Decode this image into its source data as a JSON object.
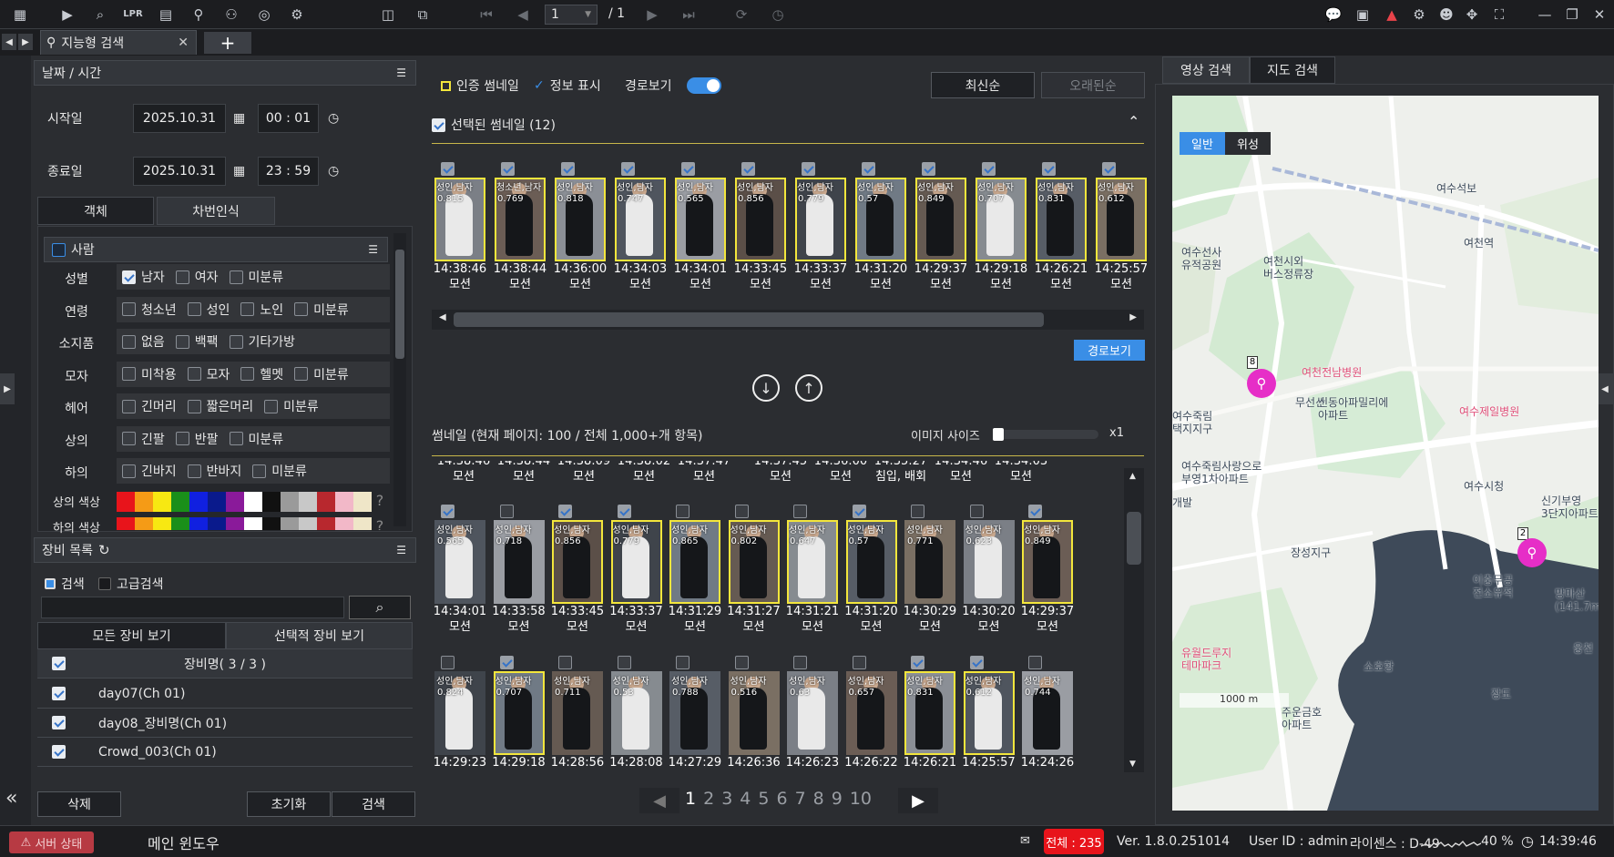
{
  "toolbar": {
    "page_current": "1",
    "page_total": "/ 1"
  },
  "tabs": {
    "main_tab_label": "지능형 검색",
    "add_tab_label": "+"
  },
  "datetime": {
    "section_title": "날짜 / 시간",
    "start_label": "시작일",
    "start_date": "2025.10.31",
    "start_time": "00 : 01",
    "end_label": "종료일",
    "end_date": "2025.10.31",
    "end_time": "23 : 59"
  },
  "search_tabs": [
    "객체",
    "차번인식"
  ],
  "person": {
    "section_title": "사람",
    "rows": [
      {
        "label": "성별",
        "options": [
          {
            "text": "남자",
            "checked": true
          },
          {
            "text": "여자",
            "checked": false
          },
          {
            "text": "미분류",
            "checked": false
          }
        ]
      },
      {
        "label": "연령",
        "options": [
          {
            "text": "청소년",
            "checked": false
          },
          {
            "text": "성인",
            "checked": false
          },
          {
            "text": "노인",
            "checked": false
          },
          {
            "text": "미분류",
            "checked": false
          }
        ]
      },
      {
        "label": "소지품",
        "options": [
          {
            "text": "없음",
            "checked": false
          },
          {
            "text": "백팩",
            "checked": false
          },
          {
            "text": "기타가방",
            "checked": false
          }
        ]
      },
      {
        "label": "모자",
        "options": [
          {
            "text": "미착용",
            "checked": false
          },
          {
            "text": "모자",
            "checked": false
          },
          {
            "text": "헬멧",
            "checked": false
          },
          {
            "text": "미분류",
            "checked": false
          }
        ]
      },
      {
        "label": "헤어",
        "options": [
          {
            "text": "긴머리",
            "checked": false
          },
          {
            "text": "짧은머리",
            "checked": false
          },
          {
            "text": "미분류",
            "checked": false
          }
        ]
      },
      {
        "label": "상의",
        "options": [
          {
            "text": "긴팔",
            "checked": false
          },
          {
            "text": "반팔",
            "checked": false
          },
          {
            "text": "미분류",
            "checked": false
          }
        ]
      },
      {
        "label": "하의",
        "options": [
          {
            "text": "긴바지",
            "checked": false
          },
          {
            "text": "반바지",
            "checked": false
          },
          {
            "text": "미분류",
            "checked": false
          }
        ]
      }
    ],
    "top_color_label": "상의 색상",
    "bottom_color_label": "하의 색상",
    "colors": [
      "#e8141b",
      "#f59b16",
      "#f7e812",
      "#1a8f1a",
      "#1020e0",
      "#0a1a8c",
      "#8a1a9a",
      "#ffffff",
      "#111111",
      "#9a9a9a",
      "#c8c8c8",
      "#b8282e",
      "#f2b8c8",
      "#efe6c8"
    ]
  },
  "devices": {
    "section_title": "장비 목록",
    "mode_basic": "검색",
    "mode_advanced": "고급검색",
    "search_value": "",
    "view_all": "모든 장비 보기",
    "view_selected": "선택적 장비 보기",
    "header": "장비명( 3 / 3 )",
    "items": [
      "day07(Ch 01)",
      "day08_장비명(Ch 01)",
      "Crowd_003(Ch 01)"
    ],
    "delete_button": "삭제",
    "reset_button": "초기화",
    "search_button": "검색"
  },
  "center": {
    "auth_thumb_label": "인증 썸네일",
    "info_label": "정보 표시",
    "route_label": "경로보기",
    "newest_button": "최신순",
    "oldest_button": "오래된순",
    "selected_header": "선택된 썸네일 (12)",
    "route_button": "경로보기",
    "thumb_header": "썸네일 (현재 페이지: 100 / 전체 1,000+개 항목)",
    "image_size_label": "이미지 사이즈",
    "image_size_value": "x1",
    "selected_thumbs": [
      {
        "tag": "성인,남자",
        "score": "0.815",
        "time": "14:38:46",
        "event": "모션"
      },
      {
        "tag": "청소년,남자",
        "score": "0.769",
        "time": "14:38:44",
        "event": "모션"
      },
      {
        "tag": "성인,남자",
        "score": "0.818",
        "time": "14:36:00",
        "event": "모션"
      },
      {
        "tag": "성인,남자",
        "score": "0.747",
        "time": "14:34:03",
        "event": "모션"
      },
      {
        "tag": "성인,남자",
        "score": "0.565",
        "time": "14:34:01",
        "event": "모션"
      },
      {
        "tag": "성인,남자",
        "score": "0.856",
        "time": "14:33:45",
        "event": "모션"
      },
      {
        "tag": "성인,남자",
        "score": "0.779",
        "time": "14:33:37",
        "event": "모션"
      },
      {
        "tag": "성인,남자",
        "score": "0.57",
        "time": "14:31:20",
        "event": "모션"
      },
      {
        "tag": "성인,남자",
        "score": "0.849",
        "time": "14:29:37",
        "event": "모션"
      },
      {
        "tag": "성인,남자",
        "score": "0.707",
        "time": "14:29:18",
        "event": "모션"
      },
      {
        "tag": "성인,남자",
        "score": "0.831",
        "time": "14:26:21",
        "event": "모션"
      },
      {
        "tag": "성인,남자",
        "score": "0.612",
        "time": "14:25:57",
        "event": "모션"
      }
    ],
    "partial_row": [
      {
        "time": "14:38:46",
        "event": "모션"
      },
      {
        "time": "14:38:44",
        "event": "모션"
      },
      {
        "time": "14:38:09",
        "event": "모션"
      },
      {
        "time": "14:38:02",
        "event": "모션"
      },
      {
        "time": "14:37:47",
        "event": "모션"
      },
      {
        "time": "14:37:45",
        "event": "모션"
      },
      {
        "time": "14:36:00",
        "event": "모션"
      },
      {
        "time": "14:35:27",
        "event": "침입, 배회"
      },
      {
        "time": "14:34:46",
        "event": "모션"
      },
      {
        "time": "14:34:03",
        "event": "모션"
      }
    ],
    "grid_row1": [
      {
        "tag": "성인,남자",
        "score": "0.565",
        "time": "14:34:01",
        "event": "모션",
        "checked": true,
        "hl": false
      },
      {
        "tag": "성인,남자",
        "score": "0.718",
        "time": "14:33:58",
        "event": "모션",
        "checked": false,
        "hl": false
      },
      {
        "tag": "성인,남자",
        "score": "0.856",
        "time": "14:33:45",
        "event": "모션",
        "checked": true,
        "hl": true
      },
      {
        "tag": "성인,남자",
        "score": "0.779",
        "time": "14:33:37",
        "event": "모션",
        "checked": true,
        "hl": true
      },
      {
        "tag": "성인,남자",
        "score": "0.865",
        "time": "14:31:29",
        "event": "모션",
        "checked": false,
        "hl": true
      },
      {
        "tag": "성인,남자",
        "score": "0.802",
        "time": "14:31:27",
        "event": "모션",
        "checked": false,
        "hl": true
      },
      {
        "tag": "성인,남자",
        "score": "0.647",
        "time": "14:31:21",
        "event": "모션",
        "checked": false,
        "hl": true
      },
      {
        "tag": "성인,남자",
        "score": "0.57",
        "time": "14:31:20",
        "event": "모션",
        "checked": true,
        "hl": true
      },
      {
        "tag": "성인,남자",
        "score": "0.771",
        "time": "14:30:29",
        "event": "모션",
        "checked": false,
        "hl": false
      },
      {
        "tag": "성인,남자",
        "score": "0.623",
        "time": "14:30:20",
        "event": "모션",
        "checked": false,
        "hl": false
      },
      {
        "tag": "성인,남자",
        "score": "0.849",
        "time": "14:29:37",
        "event": "모션",
        "checked": true,
        "hl": true
      }
    ],
    "grid_row2": [
      {
        "tag": "성인,남자",
        "score": "0.824",
        "time": "14:29:23",
        "checked": false,
        "hl": false
      },
      {
        "tag": "성인,남자",
        "score": "0.707",
        "time": "14:29:18",
        "checked": true,
        "hl": true
      },
      {
        "tag": "성인,남자",
        "score": "0.711",
        "time": "14:28:56",
        "checked": false,
        "hl": false
      },
      {
        "tag": "성인,남자",
        "score": "0.53",
        "time": "14:28:08",
        "checked": false,
        "hl": false
      },
      {
        "tag": "성인,남자",
        "score": "0.788",
        "time": "14:27:29",
        "checked": false,
        "hl": false
      },
      {
        "tag": "성인,남자",
        "score": "0.516",
        "time": "14:26:36",
        "checked": false,
        "hl": false
      },
      {
        "tag": "성인,남자",
        "score": "0.63",
        "time": "14:26:23",
        "checked": false,
        "hl": false
      },
      {
        "tag": "성인,남자",
        "score": "0.657",
        "time": "14:26:22",
        "checked": false,
        "hl": false
      },
      {
        "tag": "성인,남자",
        "score": "0.831",
        "time": "14:26:21",
        "checked": true,
        "hl": true
      },
      {
        "tag": "성인,남자",
        "score": "0.612",
        "time": "14:25:57",
        "checked": true,
        "hl": true
      },
      {
        "tag": "성인,남자",
        "score": "0.744",
        "time": "14:24:26",
        "checked": false,
        "hl": false
      }
    ],
    "pages": [
      "1",
      "2",
      "3",
      "4",
      "5",
      "6",
      "7",
      "8",
      "9",
      "10"
    ],
    "current_page": "1"
  },
  "right": {
    "tab_video": "영상 검색",
    "tab_map": "지도 검색",
    "map_mode_normal": "일반",
    "map_mode_satellite": "위성",
    "scale": "1000 m",
    "marker1": "8",
    "marker2": "2",
    "labels": [
      "여수석보",
      "여천역",
      "여수선사\n유적공원",
      "여천시외\n버스정류장",
      "여천전남병원",
      "무선산",
      "신동아파밀리에\n아파트",
      "여수제일병원",
      "여수죽림\n택지지구",
      "여수죽림사랑으로\n부영1차아파트",
      "여수시청",
      "신기부영\n3단지아파트",
      "장성지구",
      "이충무공\n전소유적",
      "망마산\n(141.7m",
      "유월드루지\n테마파크",
      "소호항",
      "장도",
      "주운금호\n아파트",
      "웅천",
      "개발"
    ]
  },
  "status": {
    "server_status": "서버 상태",
    "main_window": "메인 윈도우",
    "total": "전체 : 235",
    "version": "Ver. 1.8.0.251014",
    "user": "User ID : admin",
    "license": "라이센스 : D-49",
    "cpu": "40 %",
    "clock": "14:39:46"
  },
  "accent": "#3a8ee6",
  "highlight": "#f3e63c"
}
